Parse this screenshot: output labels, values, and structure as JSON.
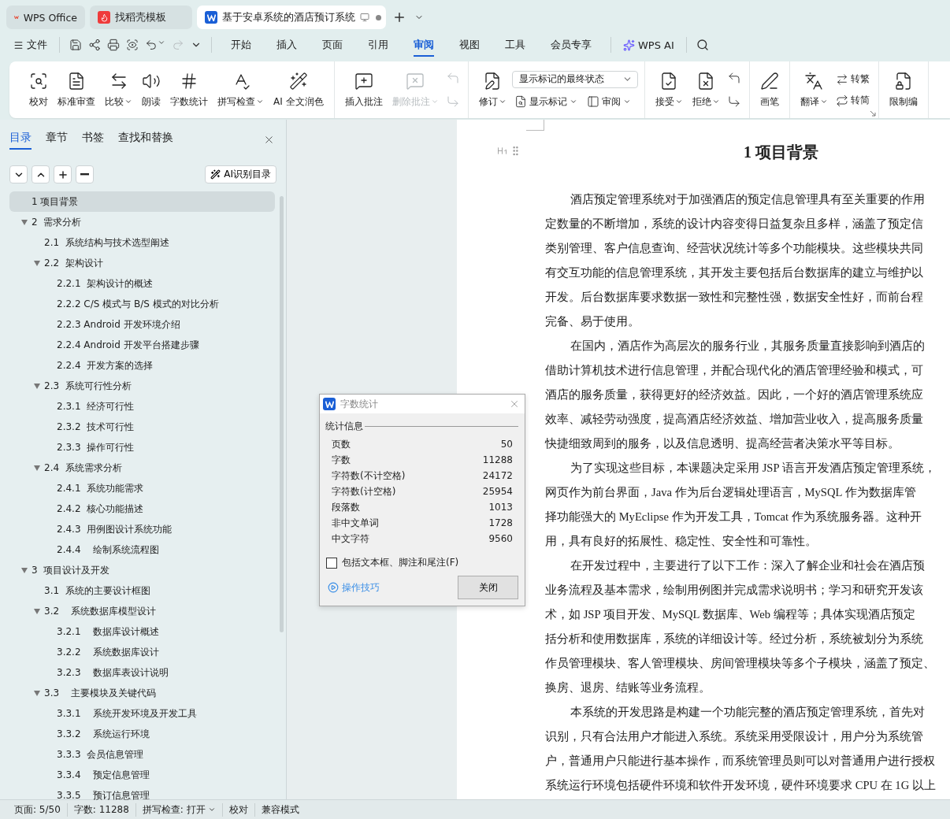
{
  "title_tabs": [
    {
      "kind": "app",
      "label": "WPS Office",
      "selected": false
    },
    {
      "kind": "template",
      "label": "找稻壳模板",
      "selected": false
    },
    {
      "kind": "doc",
      "label": "基于安卓系统的酒店预订系统",
      "selected": true
    }
  ],
  "menu": {
    "file": "文件",
    "tabs": [
      {
        "label": "开始",
        "selected": false
      },
      {
        "label": "插入",
        "selected": false
      },
      {
        "label": "页面",
        "selected": false
      },
      {
        "label": "引用",
        "selected": false
      },
      {
        "label": "审阅",
        "selected": true
      },
      {
        "label": "视图",
        "selected": false
      },
      {
        "label": "工具",
        "selected": false
      },
      {
        "label": "会员专享",
        "selected": false
      }
    ],
    "ai": "WPS AI"
  },
  "ribbon": {
    "groups": [
      {
        "items": [
          {
            "kind": "large",
            "label": "校对",
            "dropdown": false,
            "disabled": false
          },
          {
            "kind": "large",
            "label": "标准审查",
            "dropdown": false,
            "disabled": false
          },
          {
            "kind": "large",
            "label": "比较",
            "dropdown": true,
            "disabled": false
          },
          {
            "kind": "large",
            "label": "朗读",
            "dropdown": false,
            "disabled": false
          },
          {
            "kind": "large",
            "label": "字数统计",
            "dropdown": false,
            "disabled": false
          },
          {
            "kind": "large",
            "label": "拼写检查",
            "dropdown": true,
            "disabled": false
          },
          {
            "kind": "large",
            "label": "AI 全文润色",
            "dropdown": false,
            "disabled": false
          }
        ]
      },
      {
        "items": [
          {
            "kind": "large",
            "label": "插入批注",
            "dropdown": false,
            "disabled": false
          },
          {
            "kind": "large",
            "label": "删除批注",
            "dropdown": true,
            "disabled": true
          },
          {
            "kind": "icon-pair",
            "disabled": true
          }
        ]
      },
      {
        "items": [
          {
            "kind": "large",
            "label": "修订",
            "dropdown": true,
            "disabled": false
          },
          {
            "kind": "select-stack",
            "value": "显示标记的最终状态",
            "small": [
              {
                "label": "显示标记",
                "dropdown": true
              },
              {
                "label": "审阅",
                "dropdown": true
              }
            ]
          }
        ]
      },
      {
        "items": [
          {
            "kind": "large",
            "label": "接受",
            "dropdown": true,
            "disabled": false
          },
          {
            "kind": "large",
            "label": "拒绝",
            "dropdown": true,
            "disabled": false
          },
          {
            "kind": "icon-pair",
            "disabled": false
          }
        ]
      },
      {
        "items": [
          {
            "kind": "large",
            "label": "画笔",
            "dropdown": false,
            "disabled": false
          }
        ]
      },
      {
        "items": [
          {
            "kind": "large",
            "label": "翻译",
            "dropdown": true,
            "disabled": false
          },
          {
            "kind": "small-stack",
            "small": [
              {
                "label": "转繁",
                "dropdown": false
              },
              {
                "label": "转简",
                "dropdown": false
              }
            ]
          }
        ]
      },
      {
        "items": [
          {
            "kind": "large",
            "label": "限制编",
            "dropdown": false,
            "disabled": false
          }
        ]
      }
    ]
  },
  "sidebar": {
    "tabs": [
      {
        "label": "目录",
        "selected": true
      },
      {
        "label": "章节",
        "selected": false
      },
      {
        "label": "书签",
        "selected": false
      },
      {
        "label": "查找和替换",
        "selected": false
      }
    ],
    "ai_button": "AI识别目录",
    "toc": [
      {
        "label": "1 项目背景",
        "selected": true
      },
      {
        "label": "2  需求分析",
        "expanded": true,
        "selected": false,
        "children": [
          {
            "label": "2.1  系统结构与技术选型阐述",
            "selected": false
          },
          {
            "label": "2.2  架构设计",
            "expanded": true,
            "selected": false,
            "children": [
              {
                "label": "2.2.1  架构设计的概述",
                "selected": false
              },
              {
                "label": "2.2.2 C/S 模式与 B/S 模式的对比分析",
                "selected": false
              },
              {
                "label": "2.2.3 Android 开发环境介绍",
                "selected": false
              },
              {
                "label": "2.2.4 Android 开发平台搭建步骤",
                "selected": false
              },
              {
                "label": "2.2.4  开发方案的选择",
                "selected": false
              }
            ]
          },
          {
            "label": "2.3  系统可行性分析",
            "expanded": true,
            "selected": false,
            "children": [
              {
                "label": "2.3.1  经济可行性",
                "selected": false
              },
              {
                "label": "2.3.2  技术可行性",
                "selected": false
              },
              {
                "label": "2.3.3  操作可行性",
                "selected": false
              }
            ]
          },
          {
            "label": "2.4  系统需求分析",
            "expanded": true,
            "selected": false,
            "children": [
              {
                "label": "2.4.1  系统功能需求",
                "selected": false
              },
              {
                "label": "2.4.2  核心功能描述",
                "selected": false
              },
              {
                "label": "2.4.3  用例图设计系统功能",
                "selected": false
              },
              {
                "label": "2.4.4    绘制系统流程图",
                "selected": false
              }
            ]
          }
        ]
      },
      {
        "label": "3  项目设计及开发",
        "expanded": true,
        "selected": false,
        "children": [
          {
            "label": "3.1  系统的主要设计框图",
            "selected": false
          },
          {
            "label": "3.2    系统数据库模型设计",
            "expanded": true,
            "selected": false,
            "children": [
              {
                "label": "3.2.1    数据库设计概述",
                "selected": false
              },
              {
                "label": "3.2.2    系统数据库设计",
                "selected": false
              },
              {
                "label": "3.2.3    数据库表设计说明",
                "selected": false
              }
            ]
          },
          {
            "label": "3.3    主要模块及关键代码",
            "expanded": true,
            "selected": false,
            "children": [
              {
                "label": "3.3.1    系统开发环境及开发工具",
                "selected": false
              },
              {
                "label": "3.3.2    系统运行环境",
                "selected": false
              },
              {
                "label": "3.3.3  会员信息管理",
                "selected": false
              },
              {
                "label": "3.3.4    预定信息管理",
                "selected": false
              },
              {
                "label": "3.3.5    预订信息管理",
                "selected": false
              }
            ]
          }
        ]
      }
    ]
  },
  "document": {
    "heading": "1 项目背景",
    "paragraphs": [
      [
        "酒店预定管理系统对于加强酒店的预定信息管理具有至关重要的作用",
        "定数量的不断增加，系统的设计内容变得日益复杂且多样，涵盖了预定信",
        "类别管理、客户信息查询、经营状况统计等多个功能模块。这些模块共同",
        "有交互功能的信息管理系统，其开发主要包括后台数据库的建立与维护以",
        "开发。后台数据库要求数据一致性和完整性强，数据安全性好，而前台程",
        "完备、易于使用。"
      ],
      [
        "在国内，酒店作为高层次的服务行业，其服务质量直接影响到酒店的",
        "借助计算机技术进行信息管理，并配合现代化的酒店管理经验和模式，可",
        "酒店的服务质量，获得更好的经济效益。因此，一个好的酒店管理系统应",
        "效率、减轻劳动强度，提高酒店经济效益、增加营业收入，提高服务质量",
        "快捷细致周到的服务，以及信息透明、提高经营者决策水平等目标。"
      ],
      [
        "为了实现这些目标，本课题决定采用 JSP 语言开发酒店预定管理系统，",
        "网页作为前台界面，Java 作为后台逻辑处理语言，MySQL 作为数据库管",
        "择功能强大的 MyEclipse 作为开发工具，Tomcat 作为系统服务器。这种开",
        "用，具有良好的拓展性、稳定性、安全性和可靠性。"
      ],
      [
        "在开发过程中，主要进行了以下工作：深入了解企业和社会在酒店预",
        "业务流程及基本需求，绘制用例图并完成需求说明书；学习和研究开发该",
        "术，如 JSP 项目开发、MySQL 数据库、Web 编程等；具体实现酒店预定",
        "括分析和使用数据库，系统的详细设计等。经过分析，系统被划分为系统",
        "作员管理模块、客人管理模块、房间管理模块等多个子模块，涵盖了预定、",
        "换房、退房、结账等业务流程。"
      ],
      [
        "本系统的开发思路是构建一个功能完整的酒店预定管理系统，首先对",
        "识别，只有合法用户才能进入系统。系统采用受限设计，用户分为系统管",
        "户，普通用户只能进行基本操作，而系统管理员则可以对普通用户进行授权",
        "系统运行环境包括硬件环境和软件开发环境，硬件环境要求 CPU 在 1G 以上"
      ]
    ]
  },
  "dialog": {
    "title": "字数统计",
    "section": "统计信息",
    "rows": [
      {
        "label": "页数",
        "value": "50"
      },
      {
        "label": "字数",
        "value": "11288"
      },
      {
        "label": "字符数(不计空格)",
        "value": "24172"
      },
      {
        "label": "字符数(计空格)",
        "value": "25954"
      },
      {
        "label": "段落数",
        "value": "1013"
      },
      {
        "label": "非中文单词",
        "value": "1728"
      },
      {
        "label": "中文字符",
        "value": "9560"
      }
    ],
    "checkbox": {
      "label": "包括文本框、脚注和尾注(F)",
      "checked": false
    },
    "tips": "操作技巧",
    "close": "关闭"
  },
  "status_bar": [
    {
      "kind": "text",
      "label": "页面: 5/50"
    },
    {
      "kind": "text",
      "label": "字数: 11288"
    },
    {
      "kind": "dropdown",
      "label": "拼写检查: 打开"
    },
    {
      "kind": "text",
      "label": "校对"
    },
    {
      "kind": "text",
      "label": "兼容模式"
    }
  ]
}
